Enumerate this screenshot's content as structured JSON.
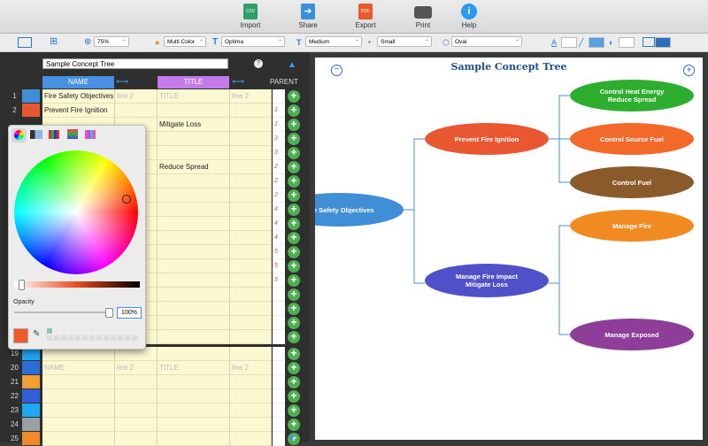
{
  "toolbar": {
    "import": "Import",
    "share": "Share",
    "export": "Export",
    "print": "Print",
    "help": "Help"
  },
  "format": {
    "zoom": "75%",
    "color_mode": "Multi Color",
    "font": "Optima",
    "weight": "Medium",
    "size": "Small",
    "shape": "Oval"
  },
  "outline": {
    "title": "Sample Concept Tree",
    "help": "?",
    "col_name": "NAME",
    "col_title": "TITLE",
    "col_parent": "PARENT",
    "placeholder_name": "NAME",
    "placeholder_line2": "line 2",
    "placeholder_title": "TITLE",
    "rows": [
      {
        "num": "1",
        "name": "Fire Safety Objectives",
        "line2": "line 2",
        "title": "TITLE",
        "title_line2": "line 2",
        "parent": "",
        "color": "#3f8ed6"
      },
      {
        "num": "2",
        "name": "Prevent Fire Ignition",
        "line2": "",
        "title": "",
        "title_line2": "",
        "parent": "1",
        "color": "#e8572f"
      },
      {
        "num": "",
        "name": "",
        "line2": "",
        "title": "Mitigate Loss",
        "title_line2": "",
        "parent": "1",
        "color": ""
      },
      {
        "num": "",
        "name": "",
        "line2": "",
        "title": "",
        "title_line2": "",
        "parent": "3",
        "color": ""
      },
      {
        "num": "",
        "name": "",
        "line2": "",
        "title": "",
        "title_line2": "",
        "parent": "3",
        "color": ""
      },
      {
        "num": "",
        "name": "",
        "line2": "",
        "title": "Reduce Spread",
        "title_line2": "",
        "parent": "2",
        "color": ""
      },
      {
        "num": "",
        "name": "",
        "line2": "",
        "title": "",
        "title_line2": "",
        "parent": "2",
        "color": ""
      },
      {
        "num": "",
        "name": "",
        "line2": "",
        "title": "",
        "title_line2": "",
        "parent": "2",
        "color": ""
      },
      {
        "num": "",
        "name": "",
        "line2": "",
        "title": "",
        "title_line2": "",
        "parent": "4",
        "color": ""
      },
      {
        "num": "",
        "name": "",
        "line2": "",
        "title": "",
        "title_line2": "",
        "parent": "4",
        "color": ""
      },
      {
        "num": "",
        "name": "",
        "line2": "",
        "title": "",
        "title_line2": "",
        "parent": "4",
        "color": ""
      },
      {
        "num": "",
        "name": "",
        "line2": "",
        "title": "",
        "title_line2": "",
        "parent": "5",
        "color": ""
      },
      {
        "num": "",
        "name": "",
        "line2": "",
        "title": "",
        "title_line2": "",
        "parent": "5",
        "color": ""
      },
      {
        "num": "",
        "name": "",
        "line2": "",
        "title": "",
        "title_line2": "",
        "parent": "5",
        "color": ""
      }
    ],
    "bottom_rows": [
      {
        "num": "19",
        "color": "#1ea7f5"
      },
      {
        "num": "20",
        "color": "#2d6bd6"
      },
      {
        "num": "21",
        "color": "#f0a030"
      },
      {
        "num": "22",
        "color": "#2f5fd6"
      },
      {
        "num": "23",
        "color": "#1ea7f5"
      },
      {
        "num": "24",
        "color": "#9aa0a6"
      },
      {
        "num": "25",
        "color": "#f08a28"
      }
    ]
  },
  "color_picker": {
    "opacity_label": "Opacity",
    "opacity_value": "100%",
    "current_color": "#ef5a2a"
  },
  "diagram": {
    "title": "Sample Concept Tree",
    "nodes": {
      "root": {
        "line1": "Fire Safety Objectives",
        "color": "#3f8ed6"
      },
      "prevent": {
        "line1": "Prevent Fire Ignition",
        "color": "#e8572f"
      },
      "mitigate": {
        "line1": "Manage Fire Impact",
        "line2": "Mitigate Loss",
        "color": "#5050c8"
      },
      "heat": {
        "line1": "Control Heat Energy",
        "line2": "Reduce Spread",
        "color": "#2eae2e"
      },
      "fuel_source": {
        "line1": "Control Source Fuel",
        "color": "#f2692a"
      },
      "fuel": {
        "line1": "Control Fuel",
        "color": "#8b5a2b"
      },
      "manage_fire": {
        "line1": "Manage Fire",
        "color": "#f28a22"
      },
      "exposed": {
        "line1": "Manage Exposed",
        "color": "#8e3d98"
      }
    }
  }
}
